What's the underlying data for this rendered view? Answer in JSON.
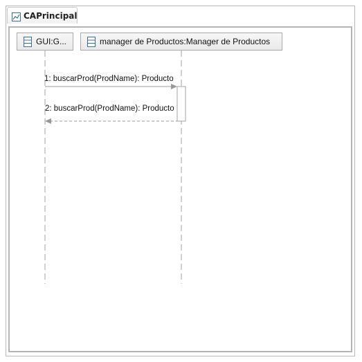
{
  "diagram": {
    "title": "CAPrincipal",
    "lifelines": [
      {
        "label": "GUI:G..."
      },
      {
        "label": "manager de Productos:Manager de Productos"
      }
    ],
    "messages": [
      {
        "label": "1: buscarProd(ProdName): Producto",
        "kind": "synchronous"
      },
      {
        "label": "2: buscarProd(ProdName): Producto",
        "kind": "reply"
      }
    ]
  },
  "colors": {
    "lifeline": "#a0a0a0",
    "arrow": "#999999",
    "frame": "#b4b4b4"
  }
}
